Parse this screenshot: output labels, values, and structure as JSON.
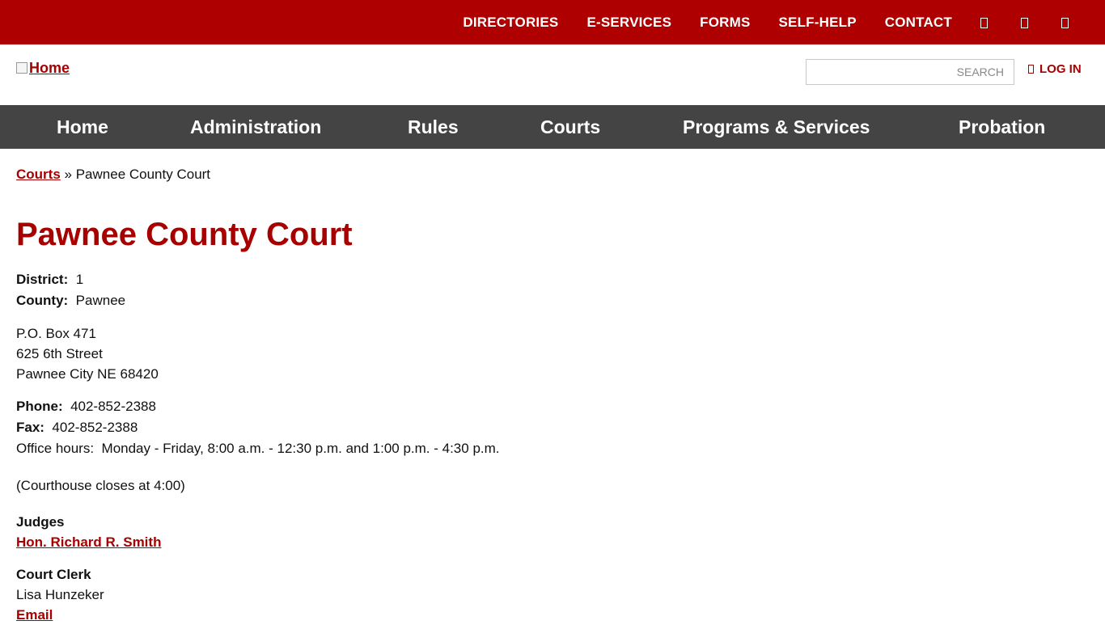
{
  "topnav": {
    "links": [
      "DIRECTORIES",
      "E-SERVICES",
      "FORMS",
      "SELF-HELP",
      "CONTACT"
    ],
    "icons": [
      "facebook-icon",
      "twitter-icon",
      "youtube-icon"
    ]
  },
  "header": {
    "logo_alt": "Home",
    "search_placeholder": "SEARCH",
    "login_label": "LOG IN"
  },
  "mainnav": {
    "items": [
      "Home",
      "Administration",
      "Rules",
      "Courts",
      "Programs & Services",
      "Probation"
    ]
  },
  "breadcrumb": {
    "parent": "Courts",
    "separator": "»",
    "current": "Pawnee County Court"
  },
  "page": {
    "title": "Pawnee County Court",
    "district_label": "District:",
    "district_value": "1",
    "county_label": "County:",
    "county_value": "Pawnee",
    "address": [
      "P.O. Box 471",
      "625 6th Street",
      "Pawnee City NE 68420"
    ],
    "phone_label": "Phone:",
    "phone_value": "402-852-2388",
    "fax_label": "Fax:",
    "fax_value": "402-852-2388",
    "hours_label": "Office hours:",
    "hours_value": "Monday - Friday, 8:00 a.m. - 12:30 p.m. and 1:00 p.m. - 4:30 p.m.",
    "courthouse_note": "(Courthouse closes at 4:00)",
    "judges_label": "Judges",
    "judge_name": "Hon. Richard R. Smith",
    "clerk_label": "Court Clerk",
    "clerk_name": "Lisa Hunzeker",
    "email_label": "Email"
  },
  "colors": {
    "brand_red": "#ae0000",
    "nav_gray": "#444444",
    "link_red": "#a60000"
  }
}
